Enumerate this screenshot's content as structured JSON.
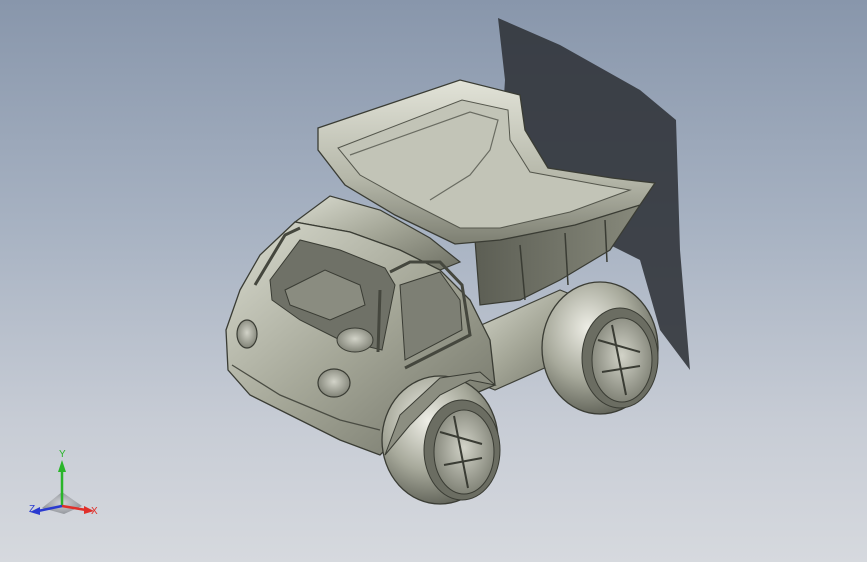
{
  "scene": {
    "background_top": "#8896ab",
    "background_bottom": "#d6d9de",
    "model_name": "dump-truck-toy",
    "model_color": "#a9ab9d"
  },
  "triad": {
    "x_label": "X",
    "y_label": "Y",
    "z_label": "Z",
    "x_color": "#e0302a",
    "y_color": "#2ab52a",
    "z_color": "#2a3ad0"
  }
}
